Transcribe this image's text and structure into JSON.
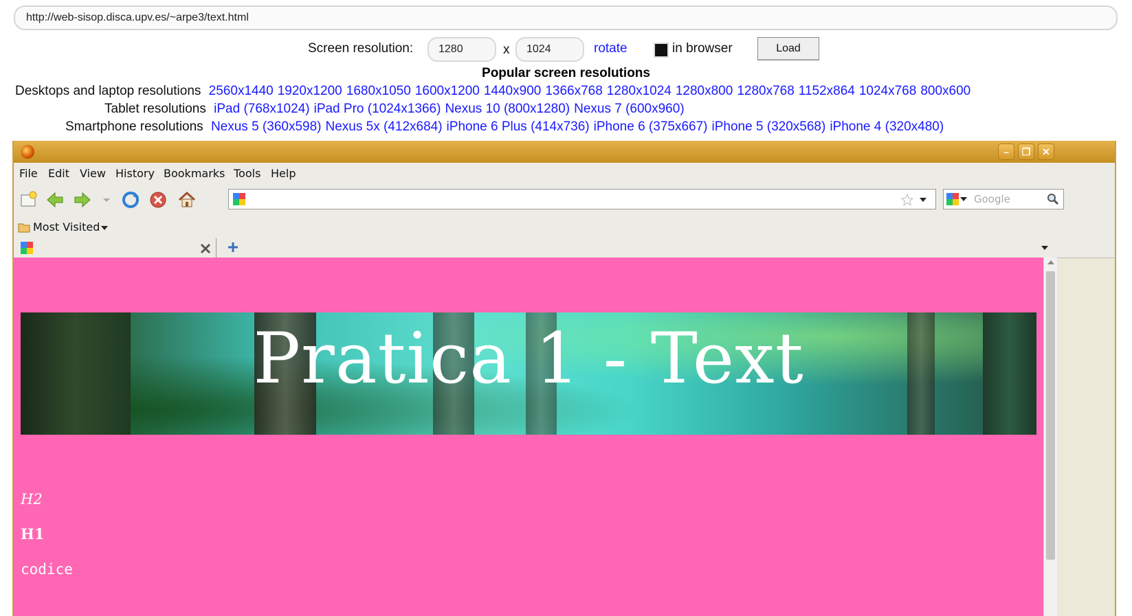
{
  "simulator": {
    "url": "http://web-sisop.disca.upv.es/~arpe3/text.html",
    "screen_resolution_label": "Screen resolution:",
    "width": "1280",
    "x_label": "x",
    "height": "1024",
    "rotate_label": "rotate",
    "in_browser_label": "in browser",
    "in_browser_checked": true,
    "load_label": "Load"
  },
  "popular": {
    "title": "Popular screen resolutions",
    "desktop_label": "Desktops and laptop resolutions",
    "desktop": [
      "2560x1440",
      "1920x1200",
      "1680x1050",
      "1600x1200",
      "1440x900",
      "1366x768",
      "1280x1024",
      "1280x800",
      "1280x768",
      "1152x864",
      "1024x768",
      "800x600"
    ],
    "tablet_label": "Tablet resolutions",
    "tablet": [
      "iPad (768x1024)",
      "iPad Pro (1024x1366)",
      "Nexus 10 (800x1280)",
      "Nexus 7 (600x960)"
    ],
    "smartphone_label": "Smartphone resolutions",
    "smartphone": [
      "Nexus 5 (360x598)",
      "Nexus 5x (412x684)",
      "iPhone 6 Plus (414x736)",
      "iPhone 6 (375x667)",
      "iPhone 5 (320x568)",
      "iPhone 4 (320x480)"
    ]
  },
  "browser": {
    "menu": [
      "File",
      "Edit",
      "View",
      "History",
      "Bookmarks",
      "Tools",
      "Help"
    ],
    "search_placeholder": "Google",
    "bookmarks_label": "Most Visited",
    "colors": {
      "titlebar": "#d9a033",
      "page_bg": "#ff66b3"
    }
  },
  "page": {
    "banner_title": "Pratica 1 - Text",
    "h2": "H2",
    "h1": "H1",
    "code": "codice"
  }
}
